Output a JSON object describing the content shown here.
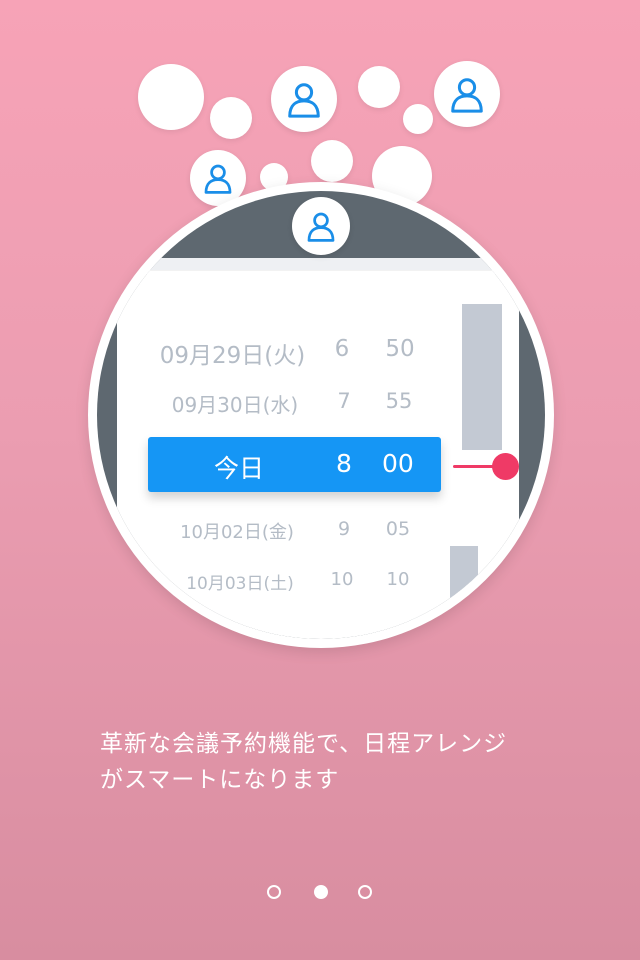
{
  "picker": {
    "rows": [
      {
        "date": "09月29日(火)",
        "hour": "6",
        "minute": "50"
      },
      {
        "date": "09月30日(水)",
        "hour": "7",
        "minute": "55"
      },
      {
        "date": "今日",
        "hour": "8",
        "minute": "00"
      },
      {
        "date": "10月02日(金)",
        "hour": "9",
        "minute": "05"
      },
      {
        "date": "10月03日(土)",
        "hour": "10",
        "minute": "10"
      }
    ],
    "selected_index": 2
  },
  "caption": {
    "line1": "革新な会議予約機能で、日程アレンジ",
    "line2": "がスマートになります"
  },
  "pagination": {
    "total": 3,
    "current": 2
  },
  "colors": {
    "accent_blue": "#1596f5",
    "slider_red": "#ef3a66",
    "background_top": "#f7a3b7",
    "background_bottom": "#d88da0"
  },
  "icons": {
    "avatar": "person-icon"
  }
}
